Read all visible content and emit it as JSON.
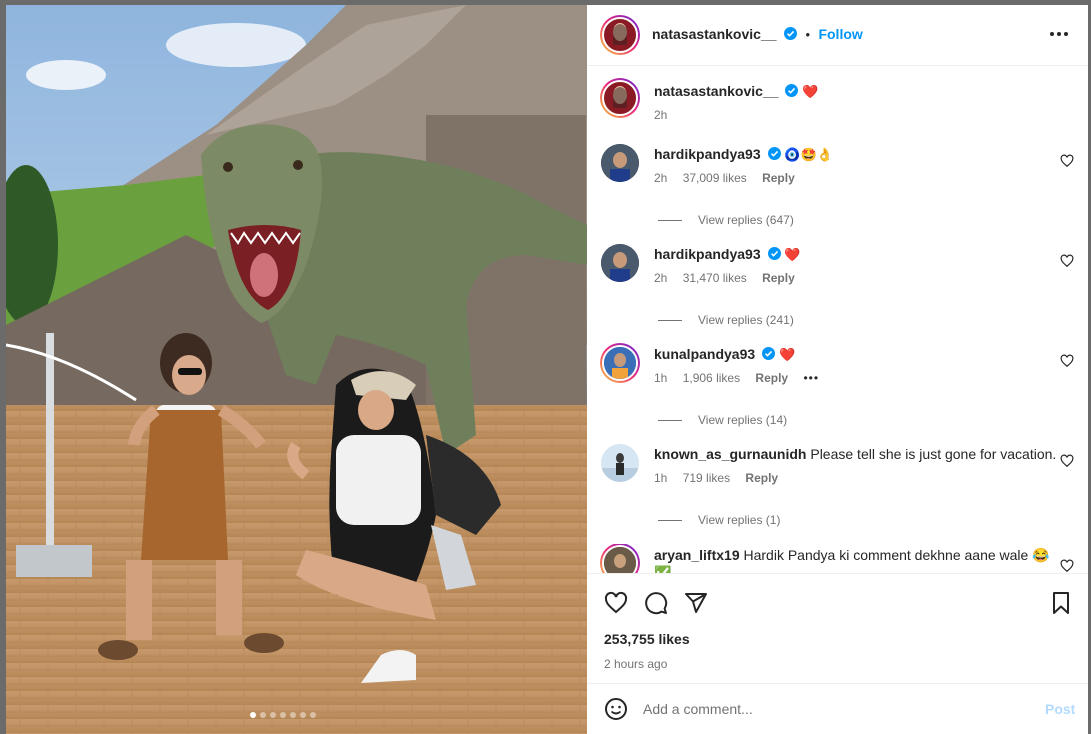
{
  "post": {
    "author": "natasastankovic__",
    "follow_label": "Follow",
    "separator": "•",
    "caption_emoji": "❤️",
    "caption_time": "2h",
    "likes": "253,755 likes",
    "time_ago": "2 hours ago",
    "carousel_dots": 7,
    "carousel_active_index": 0
  },
  "comments": [
    {
      "user": "hardikpandya93",
      "verified": true,
      "text": "🧿🤩👌",
      "time": "2h",
      "likes": "37,009 likes",
      "reply": "Reply",
      "replies": "View replies (647)"
    },
    {
      "user": "hardikpandya93",
      "verified": true,
      "text": "❤️",
      "time": "2h",
      "likes": "31,470 likes",
      "reply": "Reply",
      "replies": "View replies (241)"
    },
    {
      "user": "kunalpandya93",
      "verified": true,
      "text": "❤️",
      "time": "1h",
      "likes": "1,906 likes",
      "reply": "Reply",
      "more": "•••",
      "replies": "View replies (14)"
    },
    {
      "user": "known_as_gurnaunidh",
      "verified": false,
      "text": "Please tell she is just gone for vacation.",
      "time": "1h",
      "likes": "719 likes",
      "reply": "Reply",
      "replies": "View replies (1)"
    },
    {
      "user": "aryan_liftx19",
      "verified": false,
      "text": "Hardik Pandya ki comment dekhne aane wale 😂✅"
    }
  ],
  "add_comment": {
    "placeholder": "Add a comment...",
    "post_label": "Post"
  },
  "icons": {
    "more": "more-options-icon",
    "like": "heart-outline-icon",
    "comment": "comment-icon",
    "share": "share-icon",
    "save": "bookmark-icon",
    "emoji": "smiley-icon",
    "verified": "verified-badge-icon"
  },
  "colors": {
    "link": "#0095f6",
    "verified": "#0095f6",
    "heart_red": "#ff3040",
    "post_disabled": "#b3dbff",
    "text": "#262626",
    "secondary": "#737373"
  }
}
